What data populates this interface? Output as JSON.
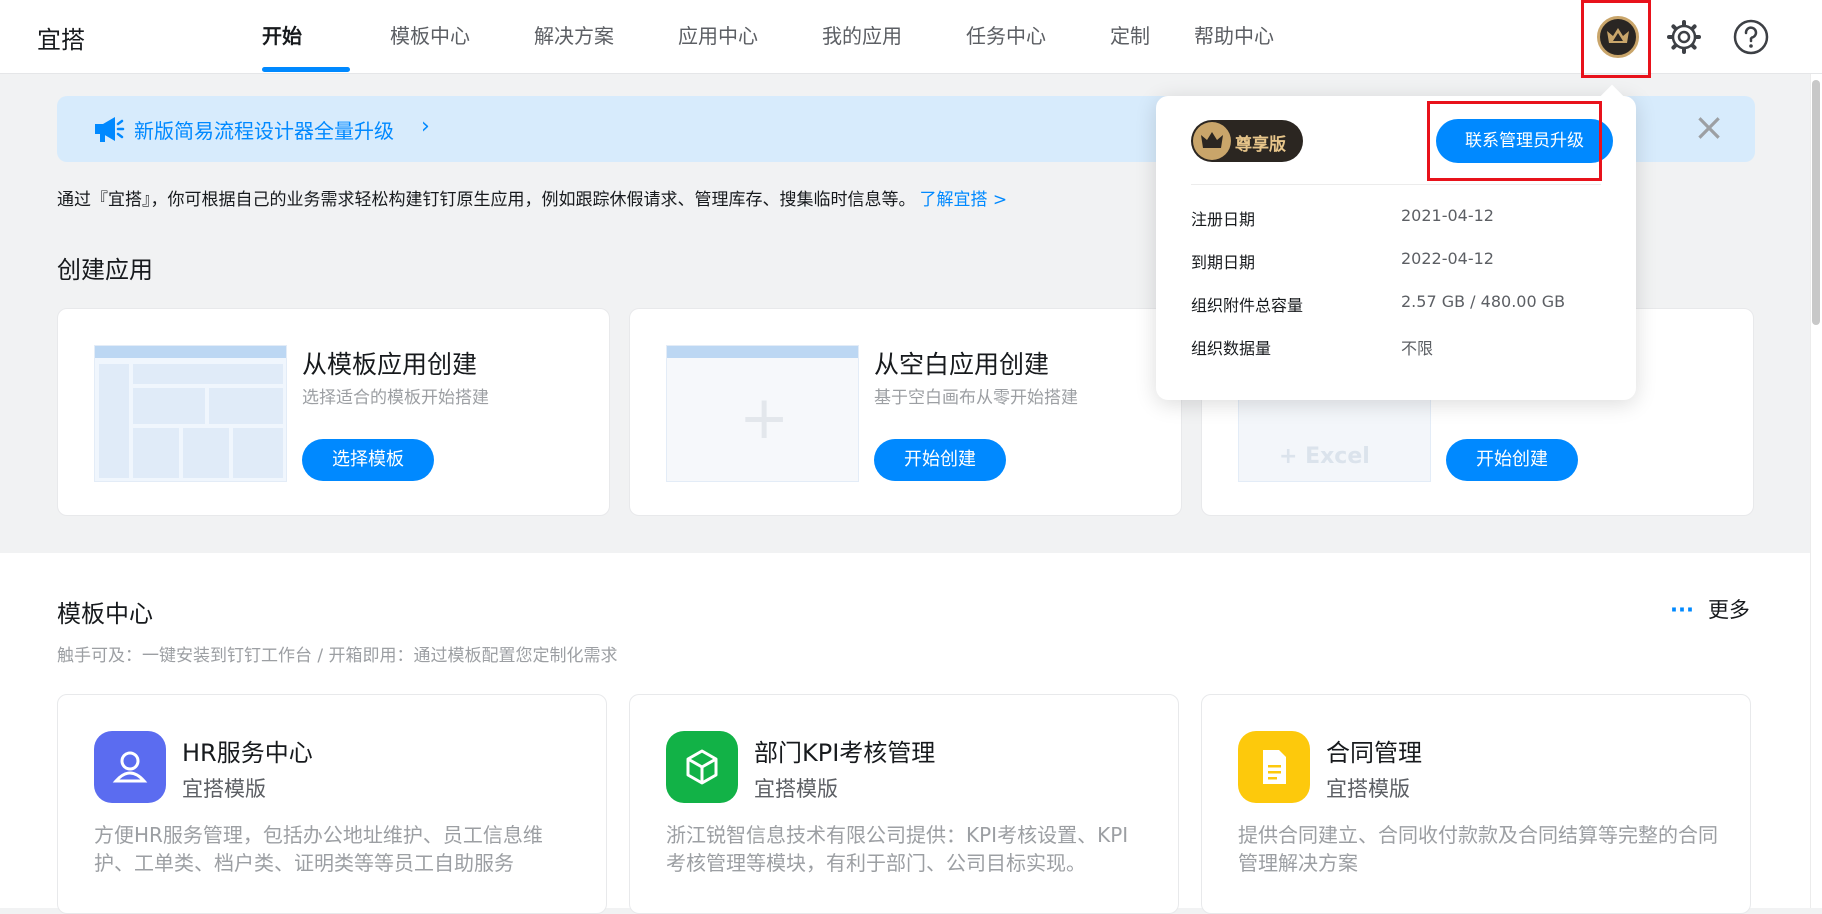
{
  "app": {
    "title": "宜搭"
  },
  "nav": {
    "items": [
      "开始",
      "模板中心",
      "解决方案",
      "应用中心",
      "我的应用",
      "任务中心",
      "定制",
      "帮助中心"
    ]
  },
  "banner": {
    "text": "新版简易流程设计器全量升级",
    "arrow": "›"
  },
  "intro": {
    "text": "通过『宜搭』，你可根据自己的业务需求轻松构建钉钉原生应用，例如跟踪休假请求、管理库存、搜集临时信息等。",
    "link": "了解宜搭 >"
  },
  "create": {
    "heading": "创建应用",
    "cards": [
      {
        "title": "从模板应用创建",
        "subtitle": "选择适合的模板开始搭建",
        "button": "选择模板"
      },
      {
        "title": "从空白应用创建",
        "subtitle": "基于空白画布从零开始搭建",
        "button": "开始创建"
      },
      {
        "title": "",
        "subtitle": "",
        "button": "开始创建",
        "mock_label": "+ Excel"
      }
    ]
  },
  "templates": {
    "heading": "模板中心",
    "more": "更多",
    "more_dots": "···",
    "subtitle": "触手可及：一键安装到钉钉工作台 / 开箱即用：通过模板配置您定制化需求",
    "cards": [
      {
        "title": "HR服务中心",
        "tag": "宜搭模版",
        "desc": "方便HR服务管理，包括办公地址维护、员工信息维护、工单类、档户类、证明类等等员工自助服务",
        "color": "#5b6cf0",
        "icon": "person-icon"
      },
      {
        "title": "部门KPI考核管理",
        "tag": "宜搭模版",
        "desc": "浙江锐智信息技术有限公司提供：KPI考核设置、KPI考核管理等模块，有利于部门、公司目标实现。",
        "color": "#12b247",
        "icon": "cube-icon"
      },
      {
        "title": "合同管理",
        "tag": "宜搭模版",
        "desc": "提供合同建立、合同收付款款及合同结算等完整的合同管理解决方案",
        "color": "#fdc90c",
        "icon": "document-icon"
      }
    ]
  },
  "popover": {
    "edition": "尊享版",
    "upgrade_button": "联系管理员升级",
    "rows": [
      {
        "key": "注册日期",
        "value": "2021-04-12"
      },
      {
        "key": "到期日期",
        "value": "2022-04-12"
      },
      {
        "key": "组织附件总容量",
        "value": "2.57 GB / 480.00 GB"
      },
      {
        "key": "组织数据量",
        "value": "不限"
      }
    ]
  },
  "colors": {
    "accent": "#0089ff",
    "highlight": "#e8121b",
    "gold": "#c9a56a"
  }
}
